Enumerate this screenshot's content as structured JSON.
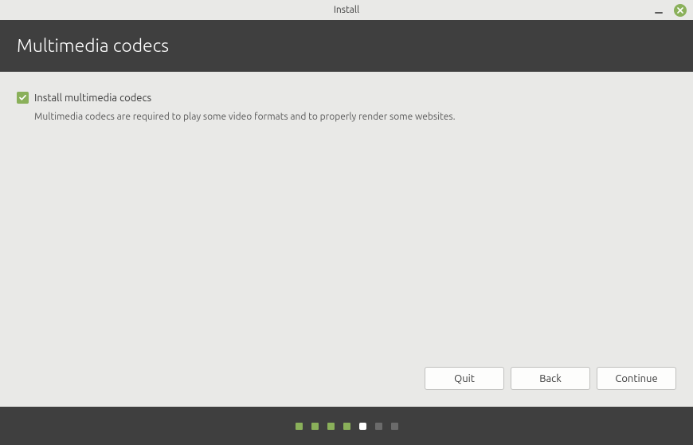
{
  "window": {
    "title": "Install"
  },
  "header": {
    "title": "Multimedia codecs"
  },
  "content": {
    "checkbox_label": "Install multimedia codecs",
    "description": "Multimedia codecs are required to play some video formats and to properly render some websites.",
    "checkbox_checked": true
  },
  "buttons": {
    "quit": "Quit",
    "back": "Back",
    "continue": "Continue"
  },
  "progress": {
    "total_steps": 7,
    "completed": 4,
    "current": 5
  },
  "colors": {
    "accent": "#8ab05a",
    "header_bg": "#3f3f3f",
    "page_bg": "#e9e9e7"
  }
}
